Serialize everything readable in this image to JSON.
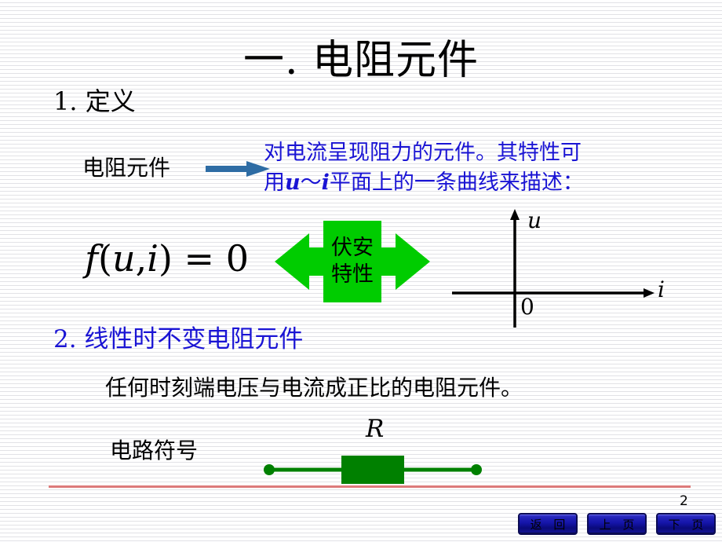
{
  "slide": {
    "title": "一. 电阻元件",
    "page_number": "2",
    "background_color": "#ffffff",
    "stripe_color": "#e2e2e6",
    "divider_color": "#dd7b7b"
  },
  "section_1": {
    "heading": "1. 定义",
    "term_label": "电阻元件",
    "arrow_color": "#2e6ca4",
    "definition_line_1": "对电流呈现阻力的元件。其特性可",
    "definition_line_2_prefix": "用",
    "definition_var_u": "u",
    "definition_tilde": "～",
    "definition_var_i": "i",
    "definition_line_2_suffix": "平面上的一条曲线来描述：",
    "definition_color": "#1a14d4",
    "formula": {
      "f": "f",
      "open": "(",
      "u": "u",
      "comma": ",",
      "i": "i",
      "close": ")",
      "equals": " = 0"
    },
    "callout": {
      "line_1": "伏安",
      "line_2": "特性",
      "fill_color": "#00cc00",
      "text_color": "#000000"
    },
    "axes": {
      "y_label": "u",
      "x_label": "i",
      "origin_label": "0",
      "stroke_color": "#000000"
    }
  },
  "section_2": {
    "heading": "2. 线性时不变电阻元件",
    "heading_color": "#1a14d4",
    "body": "任何时刻端电压与电流成正比的电阻元件。",
    "symbol_label": "电路符号",
    "resistor_label": "R",
    "circuit_color": "#008000"
  },
  "nav": {
    "buttons": [
      {
        "label": "返 回"
      },
      {
        "label": "上 页"
      },
      {
        "label": "下 页"
      }
    ],
    "button_border_color": "#0c0c54",
    "button_fill_color": "#1414a8"
  }
}
